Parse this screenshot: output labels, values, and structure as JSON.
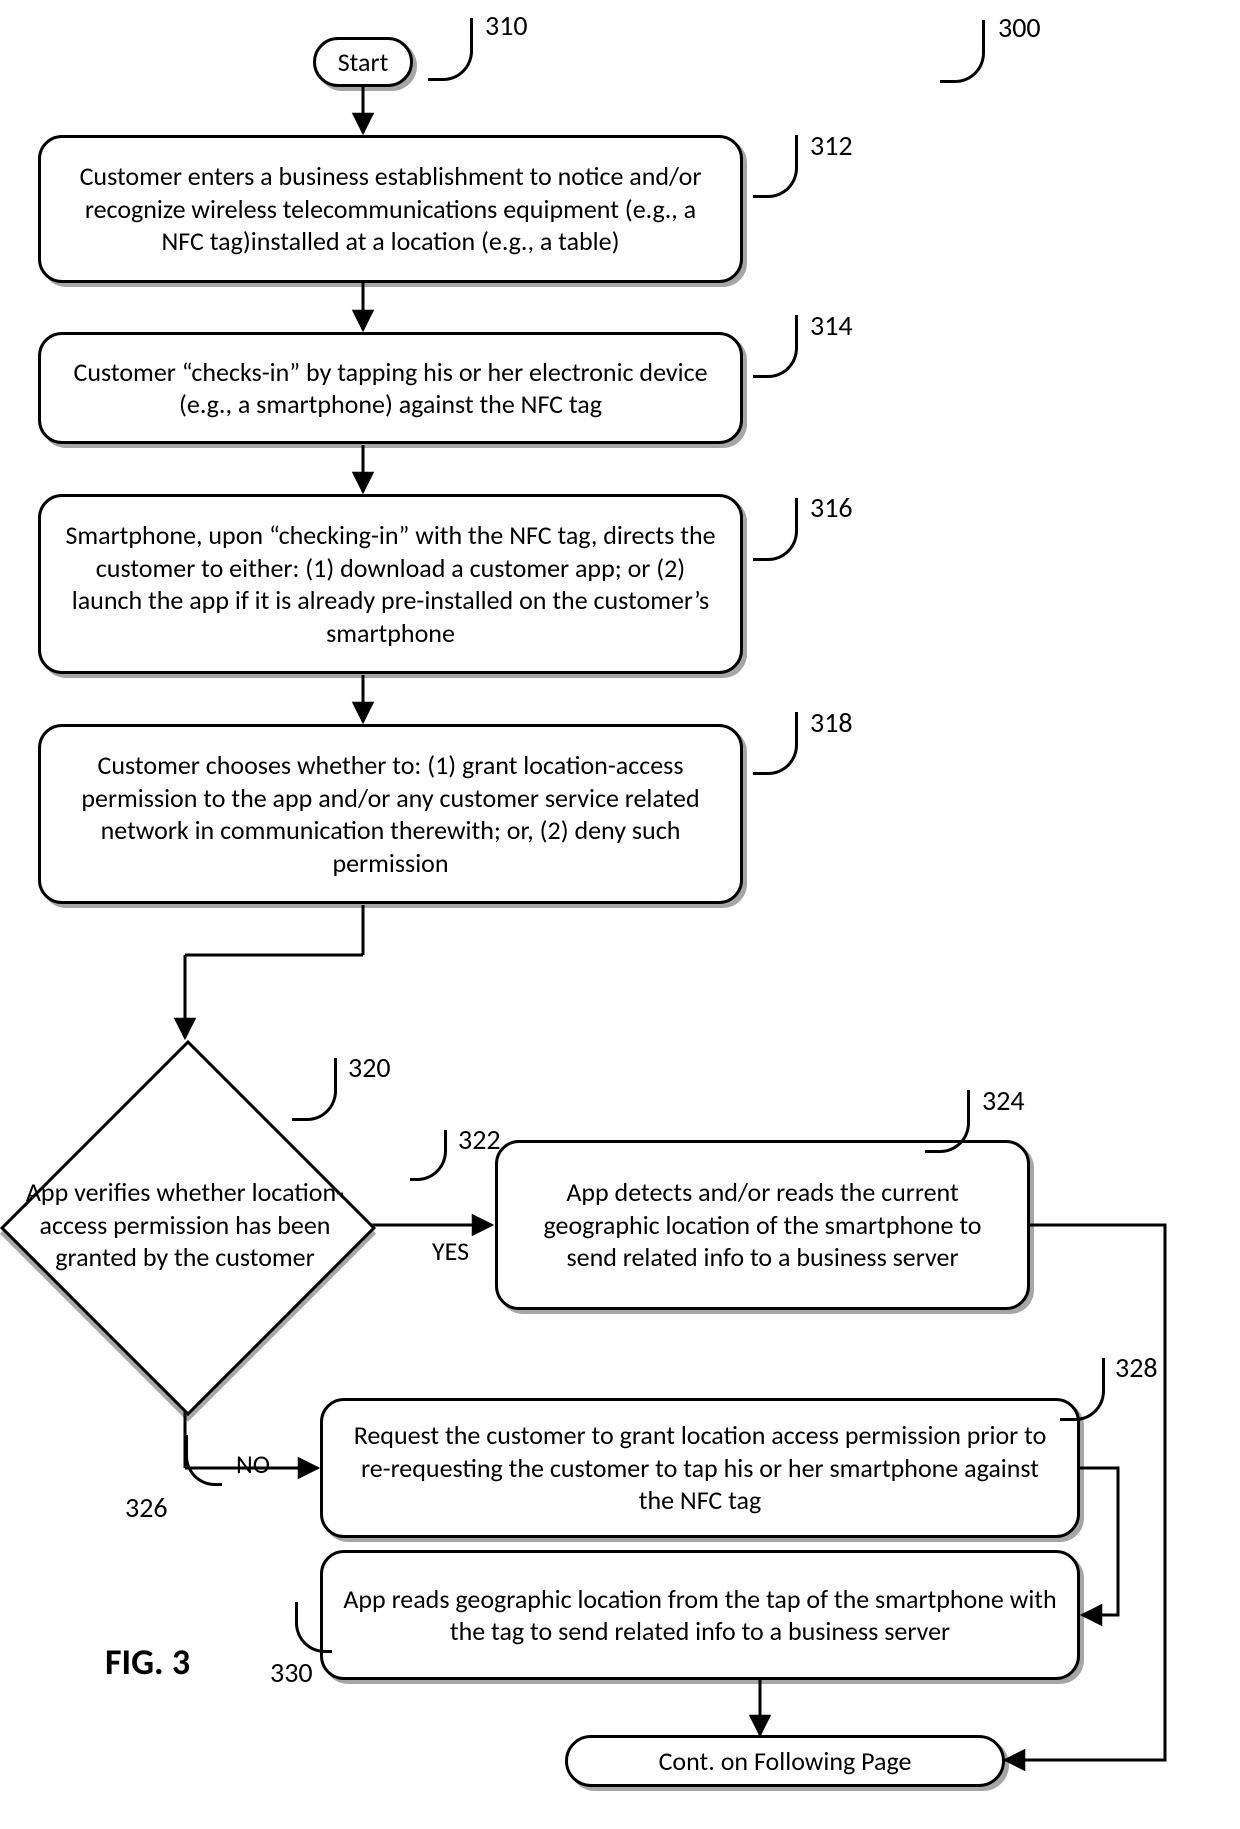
{
  "figure_ref": "300",
  "figure_label": "FIG. 3",
  "nodes": {
    "start": {
      "ref": "310",
      "text": "Start"
    },
    "step312": {
      "ref": "312",
      "text": "Customer enters a business establishment to notice and/or recognize wireless telecommunications equipment (e.g., a NFC tag)installed at a location (e.g., a table)"
    },
    "step314": {
      "ref": "314",
      "text": "Customer “checks-in” by tapping his or her electronic device (e.g., a smartphone) against the NFC tag"
    },
    "step316": {
      "ref": "316",
      "text": "Smartphone, upon “checking-in” with the NFC tag, directs the customer to either: (1) download a customer app; or (2) launch the app if it is already pre-installed on the customer’s smartphone"
    },
    "step318": {
      "ref": "318",
      "text": "Customer chooses whether to: (1) grant location-access permission to the app and/or any customer service related network in communication therewith; or, (2) deny such permission"
    },
    "decision": {
      "ref": "320",
      "text": "App verifies whether location-access permission has been granted by the customer"
    },
    "yes": {
      "ref": "322",
      "text": "YES"
    },
    "no": {
      "ref": "326",
      "text": "NO"
    },
    "step324": {
      "ref": "324",
      "text": "App detects and/or reads the current geographic location of the smartphone to send related info to a business server"
    },
    "step328": {
      "ref": "328",
      "text": "Request the customer to grant location access permission prior to re-requesting the customer to tap his or her smartphone against the NFC tag"
    },
    "step330": {
      "ref": "330",
      "text": "App reads geographic location from the tap of the smartphone with the tag to send related info to a business server"
    },
    "cont": {
      "text": "Cont. on Following Page"
    }
  }
}
